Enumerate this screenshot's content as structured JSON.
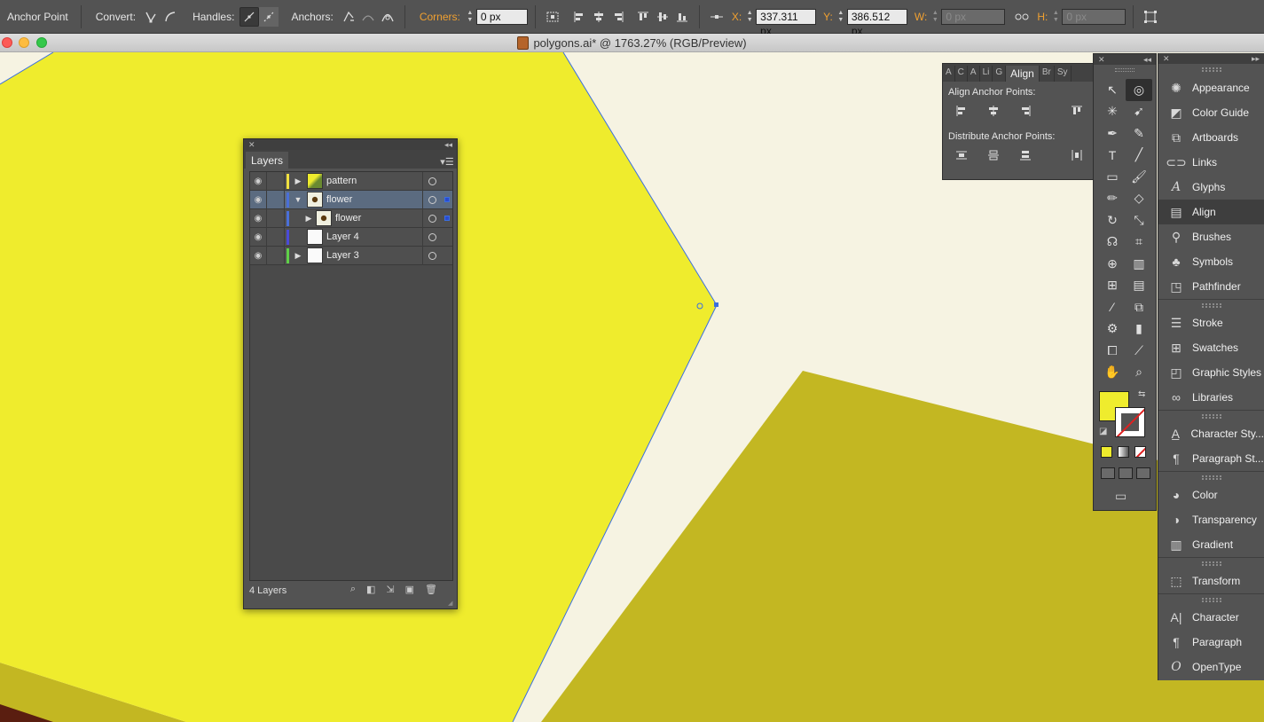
{
  "control_bar": {
    "tool_name": "Anchor Point",
    "convert_label": "Convert:",
    "handles_label": "Handles:",
    "anchors_label": "Anchors:",
    "corners_label": "Corners:",
    "corners_value": "0 px",
    "x_label": "X:",
    "x_value": "337.311 px",
    "y_label": "Y:",
    "y_value": "386.512 px",
    "w_label": "W:",
    "w_value": "0 px",
    "h_label": "H:",
    "h_value": "0 px"
  },
  "title_bar": {
    "title": "polygons.ai* @ 1763.27% (RGB/Preview)"
  },
  "colors": {
    "yellow": "#efec2d",
    "olive": "#c3b722",
    "canvas": "#f6f3e2",
    "brown": "#5a1e10",
    "selection_blue": "#3b6fe0"
  },
  "layers_panel": {
    "tab_label": "Layers",
    "footer_count": "4 Layers",
    "rows": [
      {
        "name": "pattern",
        "color": "#f0e040",
        "expanded": false
      },
      {
        "name": "flower",
        "color": "#4a6fd8",
        "expanded": true
      },
      {
        "name": "flower",
        "color": "#4a6fd8",
        "expanded": false
      },
      {
        "name": "Layer 4",
        "color": "#4a4ad8",
        "expanded": false
      },
      {
        "name": "Layer 3",
        "color": "#5fd048",
        "expanded": false
      }
    ]
  },
  "align_panel": {
    "tabs": [
      "A",
      "C",
      "A",
      "Li",
      "G",
      "Align",
      "Br",
      "Sy"
    ],
    "align_anchor_points_label": "Align Anchor Points:",
    "distribute_anchor_points_label": "Distribute Anchor Points:"
  },
  "dock_panel": {
    "items": [
      {
        "label": "Appearance",
        "icon": "appearance-icon"
      },
      {
        "label": "Color Guide",
        "icon": "color-guide-icon"
      },
      {
        "label": "Artboards",
        "icon": "artboards-icon"
      },
      {
        "label": "Links",
        "icon": "links-icon"
      },
      {
        "label": "Glyphs",
        "icon": "glyphs-icon"
      },
      {
        "label": "Align",
        "icon": "align-icon"
      },
      {
        "label": "Brushes",
        "icon": "brushes-icon"
      },
      {
        "label": "Symbols",
        "icon": "symbols-icon"
      },
      {
        "label": "Pathfinder",
        "icon": "pathfinder-icon"
      },
      {
        "label": "Stroke",
        "icon": "stroke-icon"
      },
      {
        "label": "Swatches",
        "icon": "swatches-icon"
      },
      {
        "label": "Graphic Styles",
        "icon": "graphic-styles-icon"
      },
      {
        "label": "Libraries",
        "icon": "libraries-icon"
      },
      {
        "label": "Character Sty...",
        "icon": "character-styles-icon"
      },
      {
        "label": "Paragraph St...",
        "icon": "paragraph-styles-icon"
      },
      {
        "label": "Color",
        "icon": "color-icon"
      },
      {
        "label": "Transparency",
        "icon": "transparency-icon"
      },
      {
        "label": "Gradient",
        "icon": "gradient-icon"
      },
      {
        "label": "Transform",
        "icon": "transform-icon"
      },
      {
        "label": "Character",
        "icon": "character-icon"
      },
      {
        "label": "Paragraph",
        "icon": "paragraph-icon"
      },
      {
        "label": "OpenType",
        "icon": "opentype-icon"
      }
    ]
  }
}
